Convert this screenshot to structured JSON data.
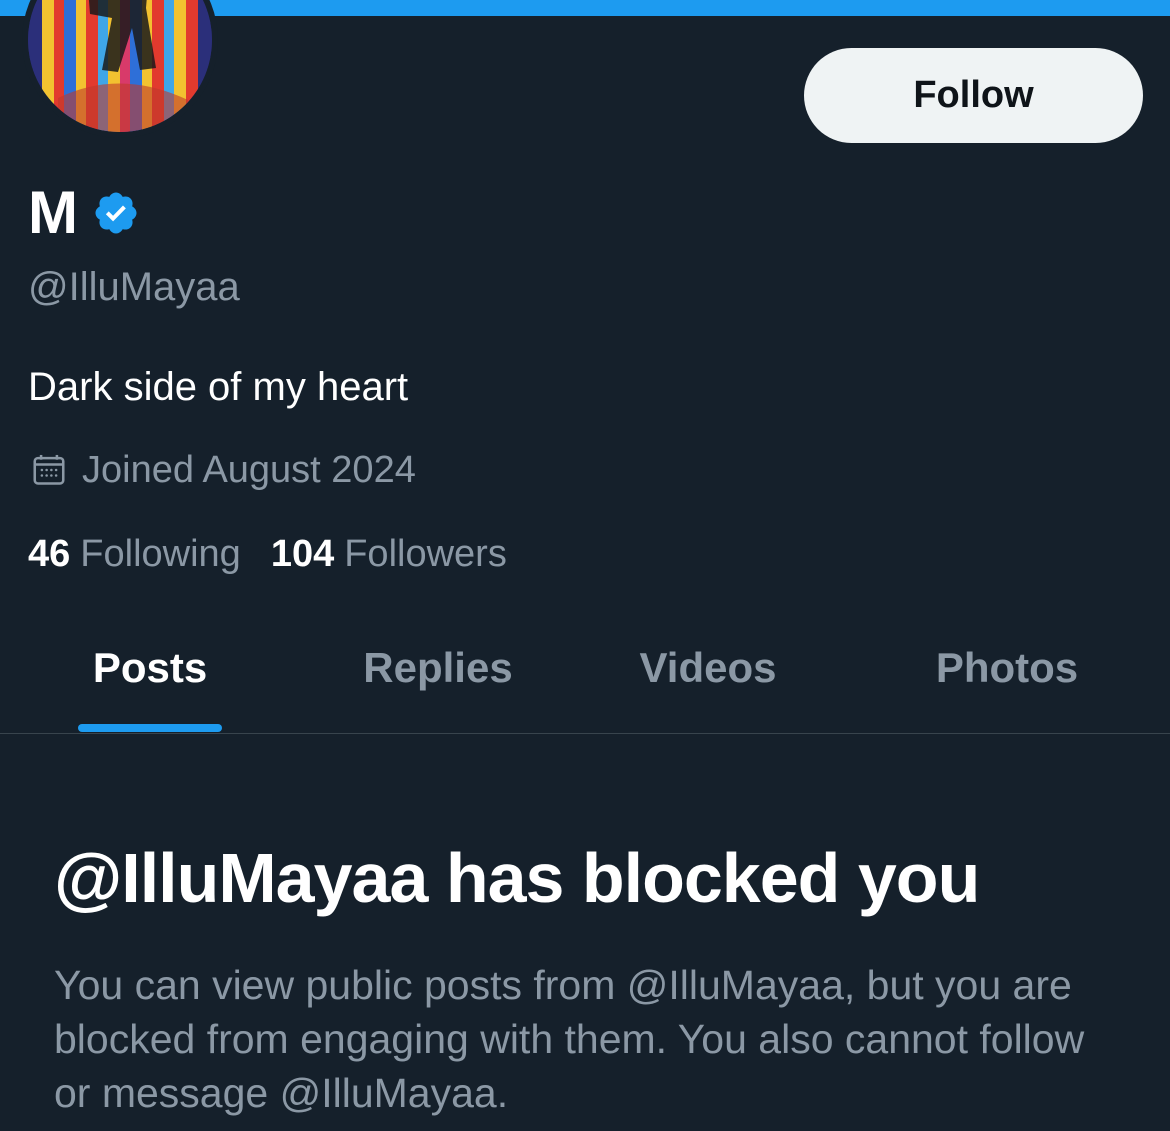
{
  "profile": {
    "display_name": "M",
    "handle": "@IlluMayaa",
    "bio": "Dark side of my heart",
    "joined": "Joined August 2024",
    "verified_icon": "verified-badge-icon",
    "calendar_icon": "calendar-icon"
  },
  "actions": {
    "follow_label": "Follow"
  },
  "stats": {
    "following_count": "46",
    "following_label": "Following",
    "followers_count": "104",
    "followers_label": "Followers"
  },
  "tabs": [
    {
      "label": "Posts",
      "active": true
    },
    {
      "label": "Replies",
      "active": false
    },
    {
      "label": "Videos",
      "active": false
    },
    {
      "label": "Photos",
      "active": false
    }
  ],
  "blocked": {
    "title": "@IlluMayaa has blocked you",
    "description": "You can view public posts from @IlluMayaa, but you are blocked from engaging with them. You also cannot follow or message @IlluMayaa."
  },
  "colors": {
    "background": "#15202b",
    "accent": "#1d9bf0",
    "primary_text": "#ffffff",
    "secondary_text": "#8b98a5",
    "button_bg": "#eff3f4",
    "divider": "#38444d"
  }
}
